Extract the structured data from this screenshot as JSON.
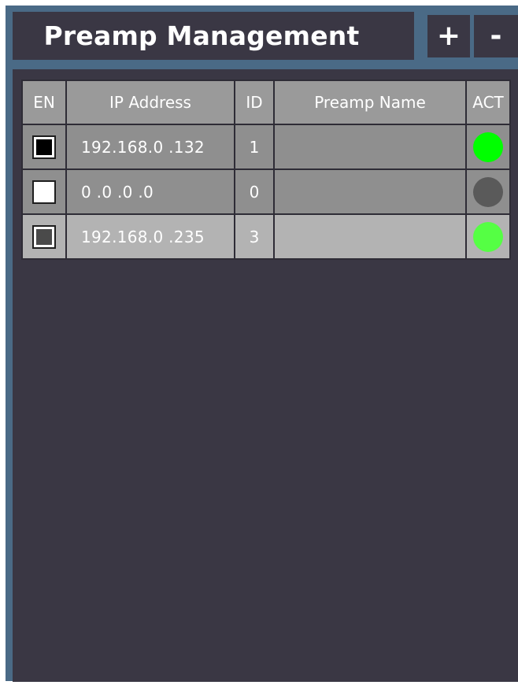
{
  "header": {
    "title": "Preamp Management",
    "add_label": "+",
    "remove_label": "-"
  },
  "table": {
    "columns": [
      "EN",
      "IP Address",
      "ID",
      "Preamp Name",
      "ACT"
    ],
    "rows": [
      {
        "enabled_state": "checked",
        "checkbox_fill": "#000000",
        "ip": "192.168.0  .132",
        "id": "1",
        "name": "",
        "act_color": "#00ff00",
        "selected": false
      },
      {
        "enabled_state": "unchecked",
        "checkbox_fill": "#ffffff",
        "ip": "0  .0  .0  .0",
        "id": "0",
        "name": "",
        "act_color": "#5a5a5a",
        "selected": false
      },
      {
        "enabled_state": "checked",
        "checkbox_fill": "#4a4a4a",
        "ip": "192.168.0  .235",
        "id": "3",
        "name": "",
        "act_color": "#55ff44",
        "selected": true
      }
    ]
  },
  "colors": {
    "frame": "#4a6a86",
    "panel": "#3a3744",
    "header_cell": "#9a9a9a",
    "row": "#8f8f8f",
    "row_selected": "#b3b3b3",
    "active_green": "#00ff00",
    "inactive_gray": "#5a5a5a"
  }
}
